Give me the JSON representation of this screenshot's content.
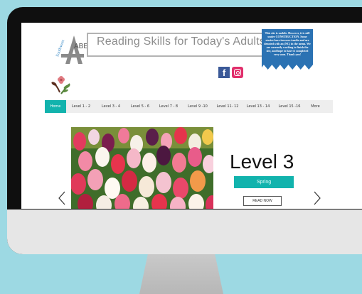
{
  "site": {
    "title": "Reading Skills for Today's Adults",
    "logo_text": "ABE",
    "logo_subtext": "Southwest",
    "notice": "This site is mobile. However, it is still under CONSTRUCTION. Some stories have incorrect audio and are denoted with an (NC) in the menu. We are currently working to finish the site, and hope to have it completed very soon. Thank you!"
  },
  "social": {
    "facebook_icon": "facebook-icon",
    "instagram_icon": "instagram-icon"
  },
  "nav": {
    "items": [
      {
        "label": "Home",
        "active": true
      },
      {
        "label": "Level 1 - 2"
      },
      {
        "label": "Level 3 - 4"
      },
      {
        "label": "Level 5 - 6"
      },
      {
        "label": "Level 7 - 8"
      },
      {
        "label": "Level 9 -10"
      },
      {
        "label": "Level 11- 12"
      },
      {
        "label": "Level 13 - 14"
      },
      {
        "label": "Level 15 -16"
      },
      {
        "label": "More"
      }
    ]
  },
  "slide": {
    "heading": "Level 3",
    "tag": "Spring",
    "button": "READ NOW",
    "image": "tulips-photo"
  },
  "colors": {
    "accent": "#12b3ad",
    "background": "#9dd9e3",
    "notice_blue": "#2b72b3"
  }
}
